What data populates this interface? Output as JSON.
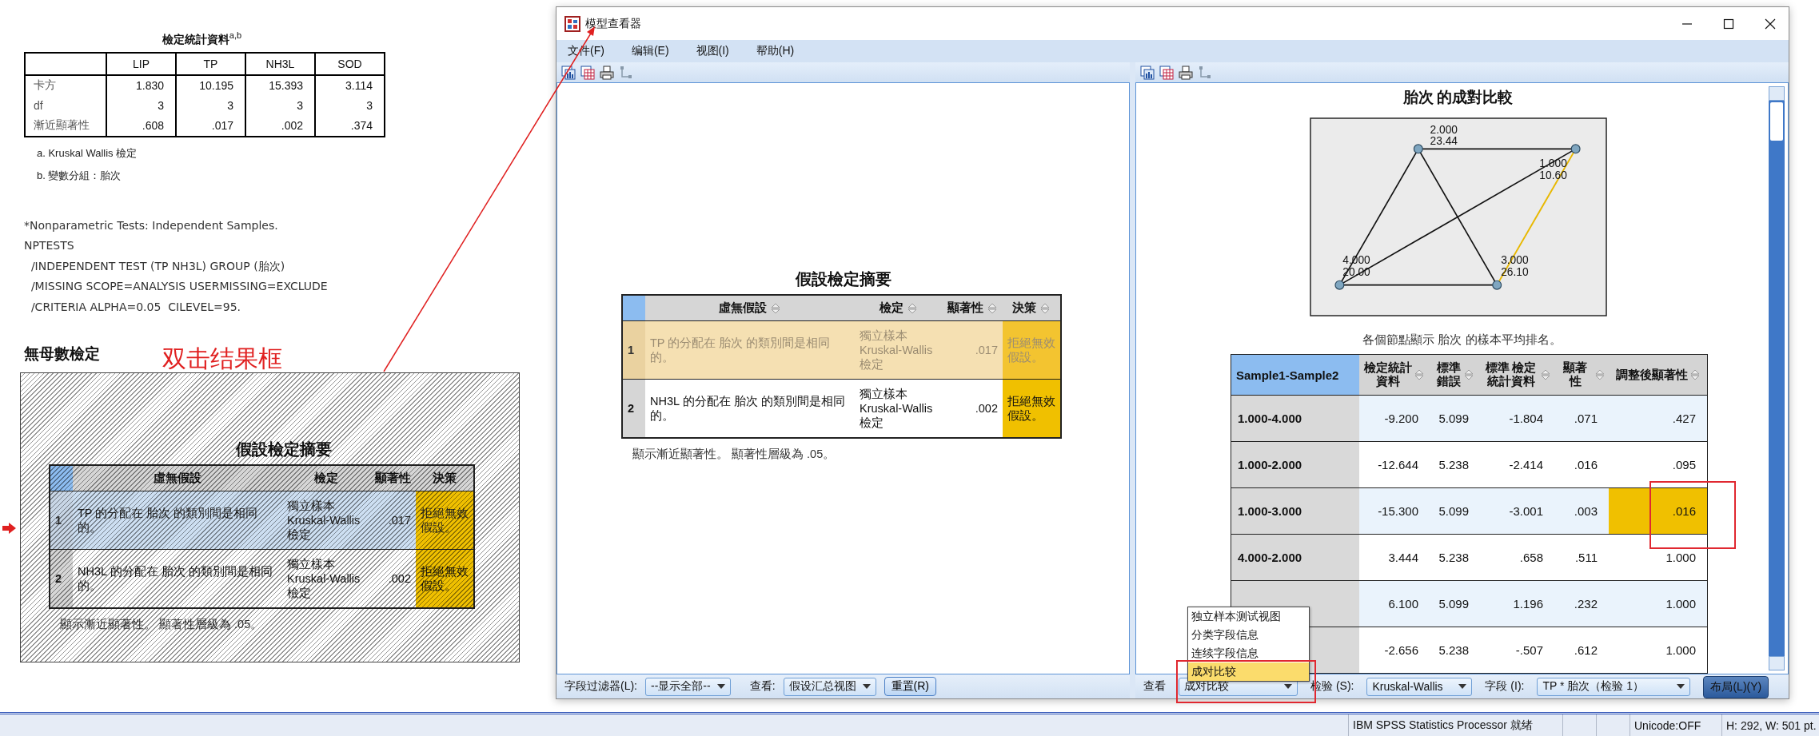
{
  "output": {
    "stats_table": {
      "title": "檢定統計資料$^{a,b}$",
      "columns": [
        "LIP",
        "TP",
        "NH3L",
        "SOD"
      ],
      "rows": [
        {
          "label": "卡方",
          "values": [
            "1.830",
            "10.195",
            "15.393",
            "3.114"
          ]
        },
        {
          "label": "df",
          "values": [
            "3",
            "3",
            "3",
            "3"
          ]
        },
        {
          "label": "漸近顯著性",
          "values": [
            ".608",
            ".017",
            ".002",
            ".374"
          ]
        }
      ]
    },
    "footnotes": [
      "a. Kruskal Wallis 檢定",
      "b. 變數分組：胎次"
    ],
    "syntax": [
      "*Nonparametric Tests: Independent Samples.",
      "NPTESTS",
      "  /INDEPENDENT TEST (TP NH3L) GROUP (胎次)",
      "  /MISSING SCOPE=ANALYSIS USERMISSING=EXCLUDE",
      "  /CRITERIA ALPHA=0.05  CILEVEL=95."
    ],
    "heading": "無母數檢定",
    "annotation": "双击结果框",
    "summary_preview": {
      "title": "假設檢定摘要",
      "columns": [
        "虛無假設",
        "檢定",
        "顯著性",
        "決策"
      ],
      "rows": [
        {
          "index": "1",
          "hypothesis": "TP 的分配在 胎次 的類別間是相同的。",
          "test": "獨立樣本 Kruskal-Wallis 檢定",
          "sig": ".017",
          "decision": "拒絕無效假設。",
          "selected": true
        },
        {
          "index": "2",
          "hypothesis": "NH3L 的分配在 胎次 的類別間是相同的。",
          "test": "獨立樣本 Kruskal-Wallis 檢定",
          "sig": ".002",
          "decision": "拒絕無效假設。",
          "selected": false
        }
      ],
      "note": "顯示漸近顯著性。 顯著性層級為 .05。"
    }
  },
  "model_viewer": {
    "title": "模型查看器",
    "menu": [
      "文件(F)",
      "编辑(E)",
      "视图(I)",
      "帮助(H)"
    ],
    "left_pane": {
      "summary": {
        "title": "假設檢定摘要",
        "columns": [
          "虛無假設",
          "檢定",
          "顯著性",
          "決策"
        ],
        "rows": [
          {
            "index": "1",
            "hypothesis": "TP 的分配在 胎次 的類別間是相同的。",
            "test": "獨立樣本 Kruskal-Wallis 檢定",
            "sig": ".017",
            "decision": "拒絕無效假設。",
            "selected": true
          },
          {
            "index": "2",
            "hypothesis": "NH3L 的分配在 胎次 的類別間是相同的。",
            "test": "獨立樣本 Kruskal-Wallis 檢定",
            "sig": ".002",
            "decision": "拒絕無效假設。",
            "selected": false
          }
        ],
        "note": "顯示漸近顯著性。 顯著性層級為 .05。"
      },
      "bottom_bar": {
        "filter_label": "字段过滤器(L):",
        "filter_value": "--显示全部--",
        "view_label": "查看:",
        "view_value": "假设汇总视图",
        "reset_button": "重置(R)"
      }
    },
    "right_pane": {
      "title": "胎次 的成對比較",
      "graph": {
        "nodes": [
          {
            "label": "2.000",
            "value": "23.44"
          },
          {
            "label": "1.000",
            "value": "10.60"
          },
          {
            "label": "4.000",
            "value": "20.00"
          },
          {
            "label": "3.000",
            "value": "26.10"
          }
        ],
        "edges": [
          {
            "significant": false
          },
          {
            "significant": false
          },
          {
            "significant": false
          },
          {
            "significant": false
          },
          {
            "significant": false
          },
          {
            "significant": true
          }
        ]
      },
      "caption": "各個節點顯示 胎次 的樣本平均排名。",
      "table": {
        "columns": [
          "Sample1-Sample2",
          "檢定統計資料",
          "標準錯誤",
          "標準 檢定統計資料",
          "顯著性",
          "調整後顯著性"
        ],
        "rows": [
          {
            "pair": "1.000-4.000",
            "values": [
              "-9.200",
              "5.099",
              "-1.804",
              ".071",
              ".427"
            ],
            "highlighted": false
          },
          {
            "pair": "1.000-2.000",
            "values": [
              "-12.644",
              "5.238",
              "-2.414",
              ".016",
              ".095"
            ],
            "highlighted": false
          },
          {
            "pair": "1.000-3.000",
            "values": [
              "-15.300",
              "5.099",
              "-3.001",
              ".003",
              ".016"
            ],
            "highlighted": true
          },
          {
            "pair": "4.000-2.000",
            "values": [
              "3.444",
              "5.238",
              ".658",
              ".511",
              "1.000"
            ],
            "highlighted": false
          },
          {
            "values": [
              "6.100",
              "5.099",
              "1.196",
              ".232",
              "1.000"
            ],
            "highlighted": false
          },
          {
            "values": [
              "-2.656",
              "5.238",
              "-.507",
              ".612",
              "1.000"
            ],
            "highlighted": false
          }
        ]
      },
      "dropdown": {
        "items": [
          {
            "label": "独立样本测试视图",
            "selected": false
          },
          {
            "label": "分类字段信息",
            "selected": false
          },
          {
            "label": "连续字段信息",
            "selected": false
          },
          {
            "label": "成对比较",
            "selected": true
          }
        ]
      },
      "bottom_bar": {
        "view_label": "查看",
        "view_value": "成对比较",
        "test_label": "检验 (S):",
        "test_value": "Kruskal-Wallis",
        "field_label": "字段 (I):",
        "field_value": "TP * 胎次（检验 1）",
        "layout_button": "布局(L)(Y)"
      }
    }
  },
  "status_bar": [
    "IBM SPSS Statistics Processor 就绪",
    "Unicode:OFF",
    "H: 292, W: 501 pt."
  ]
}
